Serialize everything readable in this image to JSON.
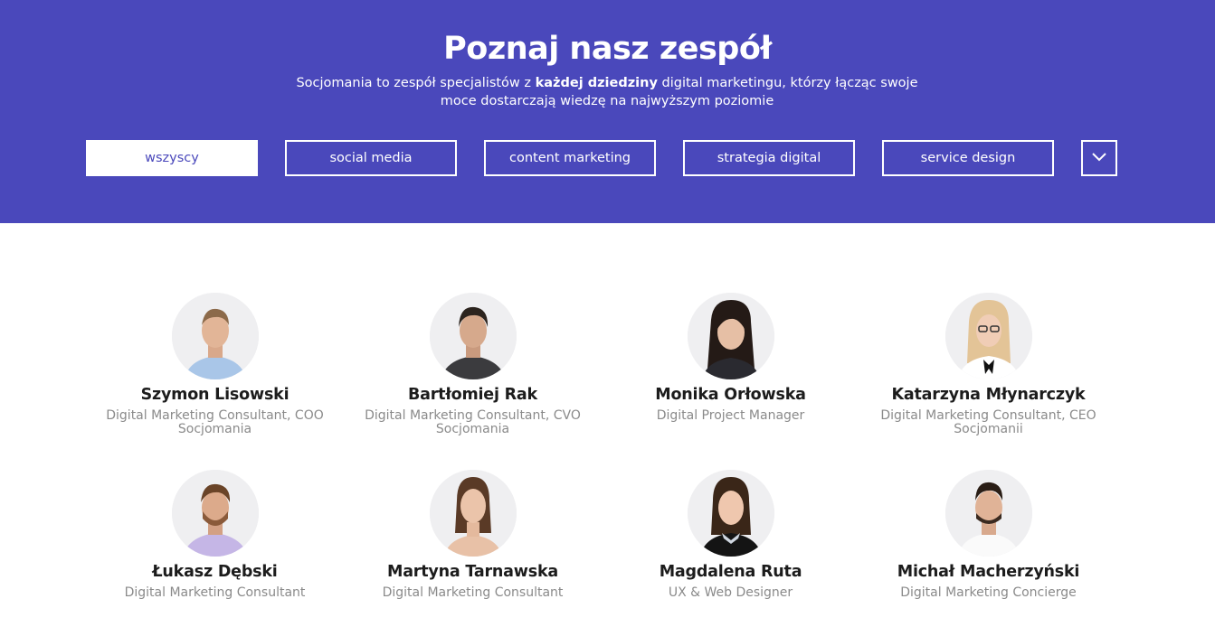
{
  "hero": {
    "title": "Poznaj nasz zespół",
    "subtitle_pre": "Socjomania to zespół specjalistów z ",
    "subtitle_bold": "każdej dziedziny",
    "subtitle_post": " digital marketingu, którzy łącząc swoje moce dostarczają wiedzę na najwyższym poziomie"
  },
  "filters": {
    "items": [
      "wszyscy",
      "social media",
      "content marketing",
      "strategia digital",
      "service design"
    ],
    "active": "wszyscy",
    "more_icon": "chevron-down-icon"
  },
  "colors": {
    "brand": "#4a48bb",
    "name": "#1c1c1c",
    "role": "#8a8a8a"
  },
  "team": [
    {
      "name": "Szymon Lisowski",
      "role": "Digital Marketing Consultant, COO Socjomania"
    },
    {
      "name": "Bartłomiej Rak",
      "role": "Digital Marketing Consultant, CVO Socjomania"
    },
    {
      "name": "Monika Orłowska",
      "role": "Digital Project Manager"
    },
    {
      "name": "Katarzyna Młynarczyk",
      "role": "Digital Marketing Consultant, CEO Socjomanii"
    },
    {
      "name": "Łukasz Dębski",
      "role": "Digital Marketing Consultant"
    },
    {
      "name": "Martyna Tarnawska",
      "role": "Digital Marketing Consultant"
    },
    {
      "name": "Magdalena Ruta",
      "role": "UX & Web Designer"
    },
    {
      "name": "Michał Macherzyński",
      "role": "Digital Marketing Concierge"
    }
  ]
}
